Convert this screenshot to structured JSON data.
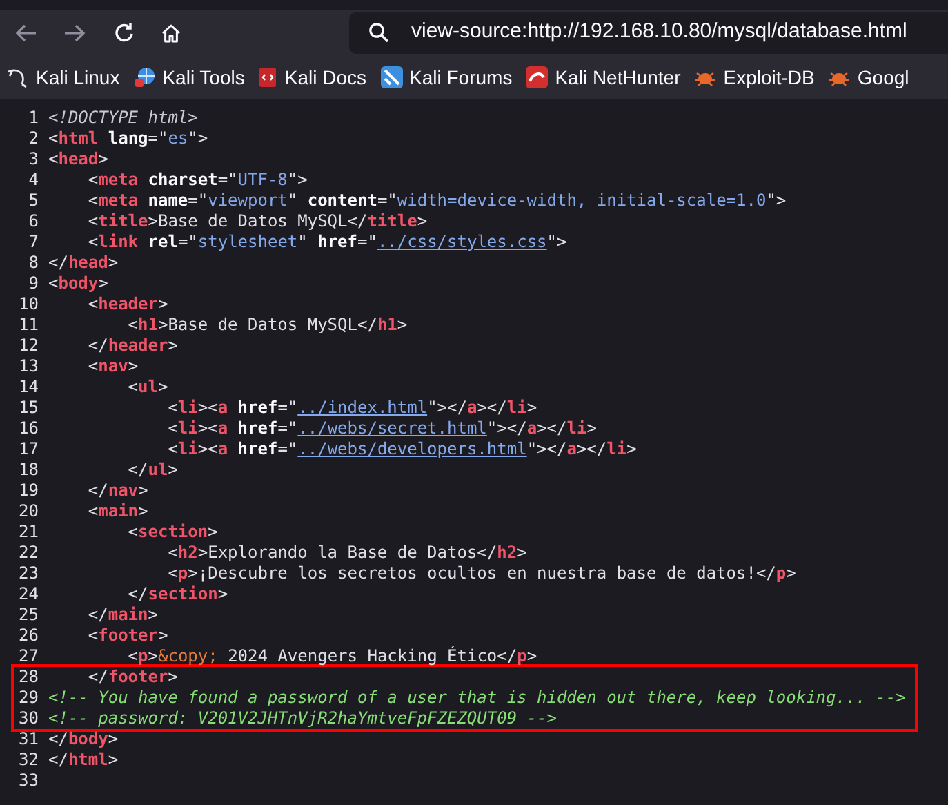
{
  "toolbar": {
    "back": {
      "disabled": true
    },
    "forward": {
      "disabled": true
    },
    "address": "view-source:http://192.168.10.80/mysql/database.html"
  },
  "bookmarks": [
    {
      "label": "Kali Linux",
      "kind": "dragon"
    },
    {
      "label": "Kali Tools",
      "kind": "tools"
    },
    {
      "label": "Kali Docs",
      "kind": "docs"
    },
    {
      "label": "Kali Forums",
      "kind": "forums"
    },
    {
      "label": "Kali NetHunter",
      "kind": "nethunter"
    },
    {
      "label": "Exploit-DB",
      "kind": "bug"
    },
    {
      "label": "Googl",
      "kind": "bug"
    }
  ],
  "source_lines": [
    {
      "number": "1",
      "highlighted": false,
      "tokens": [
        {
          "kind": "doctype",
          "text": "<!DOCTYPE html>"
        }
      ]
    },
    {
      "number": "2",
      "highlighted": false,
      "tokens": [
        {
          "kind": "punct",
          "text": "<"
        },
        {
          "kind": "tag",
          "text": "html"
        },
        {
          "kind": "attr",
          "text": " lang"
        },
        {
          "kind": "punct",
          "text": "=\""
        },
        {
          "kind": "value",
          "text": "es"
        },
        {
          "kind": "punct",
          "text": "\">"
        }
      ]
    },
    {
      "number": "3",
      "highlighted": false,
      "tokens": [
        {
          "kind": "punct",
          "text": "<"
        },
        {
          "kind": "tag",
          "text": "head"
        },
        {
          "kind": "punct",
          "text": ">"
        }
      ]
    },
    {
      "number": "4",
      "highlighted": false,
      "tokens": [
        {
          "kind": "punct",
          "text": "    <"
        },
        {
          "kind": "tag",
          "text": "meta"
        },
        {
          "kind": "attr",
          "text": " charset"
        },
        {
          "kind": "punct",
          "text": "=\""
        },
        {
          "kind": "value",
          "text": "UTF-8"
        },
        {
          "kind": "punct",
          "text": "\">"
        }
      ]
    },
    {
      "number": "5",
      "highlighted": false,
      "tokens": [
        {
          "kind": "punct",
          "text": "    <"
        },
        {
          "kind": "tag",
          "text": "meta"
        },
        {
          "kind": "attr",
          "text": " name"
        },
        {
          "kind": "punct",
          "text": "=\""
        },
        {
          "kind": "value",
          "text": "viewport"
        },
        {
          "kind": "punct",
          "text": "\" "
        },
        {
          "kind": "attr",
          "text": "content"
        },
        {
          "kind": "punct",
          "text": "=\""
        },
        {
          "kind": "value",
          "text": "width=device-width, initial-scale=1.0"
        },
        {
          "kind": "punct",
          "text": "\">"
        }
      ]
    },
    {
      "number": "6",
      "highlighted": false,
      "tokens": [
        {
          "kind": "punct",
          "text": "    <"
        },
        {
          "kind": "tag",
          "text": "title"
        },
        {
          "kind": "punct",
          "text": ">Base de Datos MySQL</"
        },
        {
          "kind": "tag",
          "text": "title"
        },
        {
          "kind": "punct",
          "text": ">"
        }
      ]
    },
    {
      "number": "7",
      "highlighted": false,
      "tokens": [
        {
          "kind": "punct",
          "text": "    <"
        },
        {
          "kind": "tag",
          "text": "link"
        },
        {
          "kind": "attr",
          "text": " rel"
        },
        {
          "kind": "punct",
          "text": "=\""
        },
        {
          "kind": "value",
          "text": "stylesheet"
        },
        {
          "kind": "punct",
          "text": "\" "
        },
        {
          "kind": "attr",
          "text": "href"
        },
        {
          "kind": "punct",
          "text": "=\""
        },
        {
          "kind": "link",
          "text": "../css/styles.css"
        },
        {
          "kind": "punct",
          "text": "\">"
        }
      ]
    },
    {
      "number": "8",
      "highlighted": false,
      "tokens": [
        {
          "kind": "punct",
          "text": "</"
        },
        {
          "kind": "tag",
          "text": "head"
        },
        {
          "kind": "punct",
          "text": ">"
        }
      ]
    },
    {
      "number": "9",
      "highlighted": false,
      "tokens": [
        {
          "kind": "punct",
          "text": "<"
        },
        {
          "kind": "tag",
          "text": "body"
        },
        {
          "kind": "punct",
          "text": ">"
        }
      ]
    },
    {
      "number": "10",
      "highlighted": false,
      "tokens": [
        {
          "kind": "punct",
          "text": "    <"
        },
        {
          "kind": "tag",
          "text": "header"
        },
        {
          "kind": "punct",
          "text": ">"
        }
      ]
    },
    {
      "number": "11",
      "highlighted": false,
      "tokens": [
        {
          "kind": "punct",
          "text": "        <"
        },
        {
          "kind": "tag",
          "text": "h1"
        },
        {
          "kind": "punct",
          "text": ">Base de Datos MySQL</"
        },
        {
          "kind": "tag",
          "text": "h1"
        },
        {
          "kind": "punct",
          "text": ">"
        }
      ]
    },
    {
      "number": "12",
      "highlighted": false,
      "tokens": [
        {
          "kind": "punct",
          "text": "    </"
        },
        {
          "kind": "tag",
          "text": "header"
        },
        {
          "kind": "punct",
          "text": ">"
        }
      ]
    },
    {
      "number": "13",
      "highlighted": false,
      "tokens": [
        {
          "kind": "punct",
          "text": "    <"
        },
        {
          "kind": "tag",
          "text": "nav"
        },
        {
          "kind": "punct",
          "text": ">"
        }
      ]
    },
    {
      "number": "14",
      "highlighted": false,
      "tokens": [
        {
          "kind": "punct",
          "text": "        <"
        },
        {
          "kind": "tag",
          "text": "ul"
        },
        {
          "kind": "punct",
          "text": ">"
        }
      ]
    },
    {
      "number": "15",
      "highlighted": false,
      "tokens": [
        {
          "kind": "punct",
          "text": "            <"
        },
        {
          "kind": "tag",
          "text": "li"
        },
        {
          "kind": "punct",
          "text": "><"
        },
        {
          "kind": "tag",
          "text": "a"
        },
        {
          "kind": "attr",
          "text": " href"
        },
        {
          "kind": "punct",
          "text": "=\""
        },
        {
          "kind": "link",
          "text": "../index.html"
        },
        {
          "kind": "punct",
          "text": "\"></"
        },
        {
          "kind": "tag",
          "text": "a"
        },
        {
          "kind": "punct",
          "text": "></"
        },
        {
          "kind": "tag",
          "text": "li"
        },
        {
          "kind": "punct",
          "text": ">"
        }
      ]
    },
    {
      "number": "16",
      "highlighted": false,
      "tokens": [
        {
          "kind": "punct",
          "text": "            <"
        },
        {
          "kind": "tag",
          "text": "li"
        },
        {
          "kind": "punct",
          "text": "><"
        },
        {
          "kind": "tag",
          "text": "a"
        },
        {
          "kind": "attr",
          "text": " href"
        },
        {
          "kind": "punct",
          "text": "=\""
        },
        {
          "kind": "link",
          "text": "../webs/secret.html"
        },
        {
          "kind": "punct",
          "text": "\"></"
        },
        {
          "kind": "tag",
          "text": "a"
        },
        {
          "kind": "punct",
          "text": "></"
        },
        {
          "kind": "tag",
          "text": "li"
        },
        {
          "kind": "punct",
          "text": ">"
        }
      ]
    },
    {
      "number": "17",
      "highlighted": false,
      "tokens": [
        {
          "kind": "punct",
          "text": "            <"
        },
        {
          "kind": "tag",
          "text": "li"
        },
        {
          "kind": "punct",
          "text": "><"
        },
        {
          "kind": "tag",
          "text": "a"
        },
        {
          "kind": "attr",
          "text": " href"
        },
        {
          "kind": "punct",
          "text": "=\""
        },
        {
          "kind": "link",
          "text": "../webs/developers.html"
        },
        {
          "kind": "punct",
          "text": "\"></"
        },
        {
          "kind": "tag",
          "text": "a"
        },
        {
          "kind": "punct",
          "text": "></"
        },
        {
          "kind": "tag",
          "text": "li"
        },
        {
          "kind": "punct",
          "text": ">"
        }
      ]
    },
    {
      "number": "18",
      "highlighted": false,
      "tokens": [
        {
          "kind": "punct",
          "text": "        </"
        },
        {
          "kind": "tag",
          "text": "ul"
        },
        {
          "kind": "punct",
          "text": ">"
        }
      ]
    },
    {
      "number": "19",
      "highlighted": false,
      "tokens": [
        {
          "kind": "punct",
          "text": "    </"
        },
        {
          "kind": "tag",
          "text": "nav"
        },
        {
          "kind": "punct",
          "text": ">"
        }
      ]
    },
    {
      "number": "20",
      "highlighted": false,
      "tokens": [
        {
          "kind": "punct",
          "text": "    <"
        },
        {
          "kind": "tag",
          "text": "main"
        },
        {
          "kind": "punct",
          "text": ">"
        }
      ]
    },
    {
      "number": "21",
      "highlighted": false,
      "tokens": [
        {
          "kind": "punct",
          "text": "        <"
        },
        {
          "kind": "tag",
          "text": "section"
        },
        {
          "kind": "punct",
          "text": ">"
        }
      ]
    },
    {
      "number": "22",
      "highlighted": false,
      "tokens": [
        {
          "kind": "punct",
          "text": "            <"
        },
        {
          "kind": "tag",
          "text": "h2"
        },
        {
          "kind": "punct",
          "text": ">Explorando la Base de Datos</"
        },
        {
          "kind": "tag",
          "text": "h2"
        },
        {
          "kind": "punct",
          "text": ">"
        }
      ]
    },
    {
      "number": "23",
      "highlighted": false,
      "tokens": [
        {
          "kind": "punct",
          "text": "            <"
        },
        {
          "kind": "tag",
          "text": "p"
        },
        {
          "kind": "punct",
          "text": ">¡Descubre los secretos ocultos en nuestra base de datos!</"
        },
        {
          "kind": "tag",
          "text": "p"
        },
        {
          "kind": "punct",
          "text": ">"
        }
      ]
    },
    {
      "number": "24",
      "highlighted": false,
      "tokens": [
        {
          "kind": "punct",
          "text": "        </"
        },
        {
          "kind": "tag",
          "text": "section"
        },
        {
          "kind": "punct",
          "text": ">"
        }
      ]
    },
    {
      "number": "25",
      "highlighted": false,
      "tokens": [
        {
          "kind": "punct",
          "text": "    </"
        },
        {
          "kind": "tag",
          "text": "main"
        },
        {
          "kind": "punct",
          "text": ">"
        }
      ]
    },
    {
      "number": "26",
      "highlighted": false,
      "tokens": [
        {
          "kind": "punct",
          "text": "    <"
        },
        {
          "kind": "tag",
          "text": "footer"
        },
        {
          "kind": "punct",
          "text": ">"
        }
      ]
    },
    {
      "number": "27",
      "highlighted": false,
      "tokens": [
        {
          "kind": "punct",
          "text": "        <"
        },
        {
          "kind": "tag",
          "text": "p"
        },
        {
          "kind": "punct",
          "text": ">"
        },
        {
          "kind": "entity",
          "text": "&copy;"
        },
        {
          "kind": "punct",
          "text": " 2024 Avengers Hacking Ético</"
        },
        {
          "kind": "tag",
          "text": "p"
        },
        {
          "kind": "punct",
          "text": ">"
        }
      ]
    },
    {
      "number": "28",
      "highlighted": true,
      "tokens": [
        {
          "kind": "punct",
          "text": "    </"
        },
        {
          "kind": "tag",
          "text": "footer"
        },
        {
          "kind": "punct",
          "text": ">"
        }
      ]
    },
    {
      "number": "29",
      "highlighted": true,
      "tokens": [
        {
          "kind": "comment",
          "text": "<!-- You have found a password of a user that is hidden out there, keep looking... -->"
        }
      ]
    },
    {
      "number": "30",
      "highlighted": true,
      "tokens": [
        {
          "kind": "comment",
          "text": "<!-- password: V201V2JHTnVjR2haYmtveFpFZEZQUT09 -->"
        }
      ]
    },
    {
      "number": "31",
      "highlighted": false,
      "tokens": [
        {
          "kind": "punct",
          "text": "</"
        },
        {
          "kind": "tag",
          "text": "body"
        },
        {
          "kind": "punct",
          "text": ">"
        }
      ]
    },
    {
      "number": "32",
      "highlighted": false,
      "tokens": [
        {
          "kind": "punct",
          "text": "</"
        },
        {
          "kind": "tag",
          "text": "html"
        },
        {
          "kind": "punct",
          "text": ">"
        }
      ]
    },
    {
      "number": "33",
      "highlighted": false
    }
  ]
}
